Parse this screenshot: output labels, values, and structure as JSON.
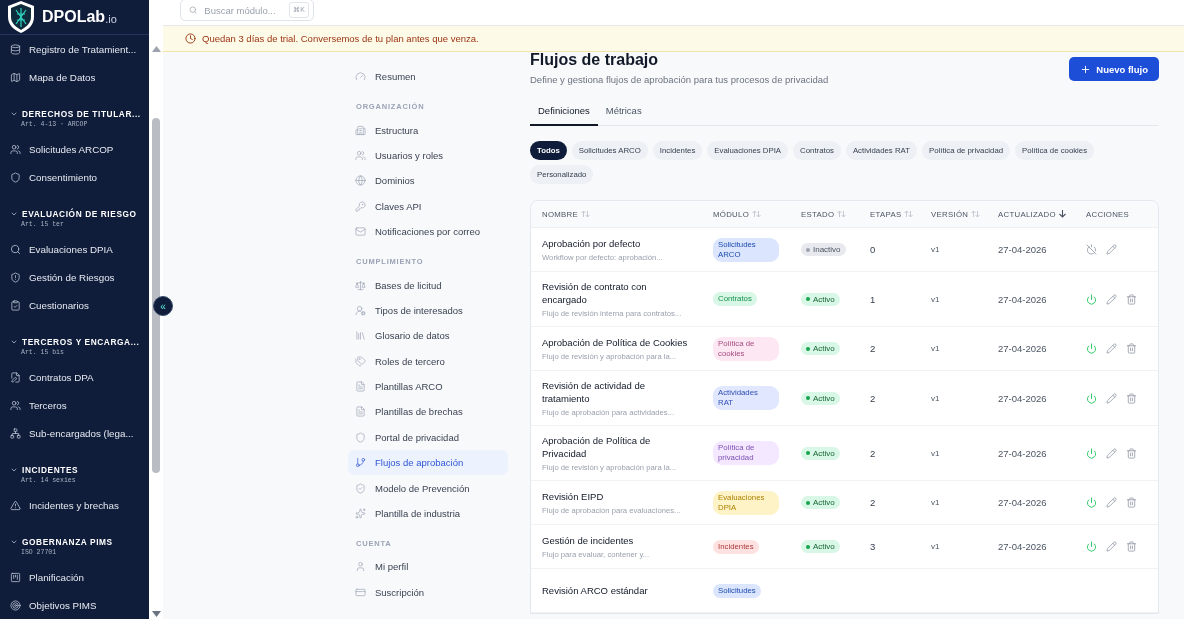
{
  "sidebar": {
    "logo": {
      "name": "DPOLab",
      "suffix": ".io"
    },
    "top_items": [
      {
        "label": "Registro de Tratamient..."
      },
      {
        "label": "Mapa de Datos"
      }
    ],
    "groups": [
      {
        "title": "DERECHOS DE TITULAR...",
        "subtitle": "Art. 4-13 · ARCOP",
        "expanded": true,
        "items": [
          {
            "label": "Solicitudes ARCOP"
          },
          {
            "label": "Consentimiento"
          }
        ]
      },
      {
        "title": "EVALUACIÓN DE RIESGO",
        "subtitle": "Art. 15 ter",
        "expanded": true,
        "items": [
          {
            "label": "Evaluaciones DPIA"
          },
          {
            "label": "Gestión de Riesgos"
          },
          {
            "label": "Cuestionarios"
          }
        ]
      },
      {
        "title": "TERCEROS Y ENCARGA...",
        "subtitle": "Art. 15 bis",
        "expanded": true,
        "items": [
          {
            "label": "Contratos DPA"
          },
          {
            "label": "Terceros"
          },
          {
            "label": "Sub-encargados (lega..."
          }
        ]
      },
      {
        "title": "INCIDENTES",
        "subtitle": "Art. 14 sexies",
        "expanded": true,
        "items": [
          {
            "label": "Incidentes y brechas"
          }
        ]
      },
      {
        "title": "GOBERNANZA PIMS",
        "subtitle": "ISO 27701",
        "expanded": true,
        "items": [
          {
            "label": "Planificación"
          },
          {
            "label": "Objetivos PIMS"
          }
        ]
      }
    ],
    "collapse_button": "«"
  },
  "search": {
    "placeholder": "Buscar módulo...",
    "shortcut": "⌘K"
  },
  "trial_banner": "Quedan 3 días de trial. Conversemos de tu plan antes que venza.",
  "settings_nav": {
    "top": [
      {
        "label": "Resumen",
        "selected": false
      }
    ],
    "sections": [
      {
        "title": "ORGANIZACIÓN",
        "items": [
          {
            "label": "Estructura",
            "selected": false
          },
          {
            "label": "Usuarios y roles",
            "selected": false
          },
          {
            "label": "Dominios",
            "selected": false
          },
          {
            "label": "Claves API",
            "selected": false
          },
          {
            "label": "Notificaciones por correo",
            "selected": false
          }
        ]
      },
      {
        "title": "CUMPLIMIENTO",
        "items": [
          {
            "label": "Bases de licitud",
            "selected": false
          },
          {
            "label": "Tipos de interesados",
            "selected": false
          },
          {
            "label": "Glosario de datos",
            "selected": false
          },
          {
            "label": "Roles de tercero",
            "selected": false
          },
          {
            "label": "Plantillas ARCO",
            "selected": false
          },
          {
            "label": "Plantillas de brechas",
            "selected": false
          },
          {
            "label": "Portal de privacidad",
            "selected": false
          },
          {
            "label": "Flujos de aprobación",
            "selected": true
          },
          {
            "label": "Modelo de Prevención",
            "selected": false
          },
          {
            "label": "Plantilla de industria",
            "selected": false
          }
        ]
      },
      {
        "title": "CUENTA",
        "items": [
          {
            "label": "Mi perfil",
            "selected": false
          },
          {
            "label": "Suscripción",
            "selected": false
          }
        ]
      }
    ]
  },
  "page": {
    "title": "Flujos de trabajo",
    "subtitle": "Define y gestiona flujos de aprobación para tus procesos de privacidad",
    "new_button": "Nuevo flujo"
  },
  "tabs": [
    {
      "label": "Definiciones",
      "selected": true
    },
    {
      "label": "Métricas",
      "selected": false
    }
  ],
  "filters": [
    {
      "label": "Todos",
      "selected": true
    },
    {
      "label": "Solicitudes ARCO",
      "selected": false
    },
    {
      "label": "Incidentes",
      "selected": false
    },
    {
      "label": "Evaluaciones DPIA",
      "selected": false
    },
    {
      "label": "Contratos",
      "selected": false
    },
    {
      "label": "Actividades RAT",
      "selected": false
    },
    {
      "label": "Política de privacidad",
      "selected": false
    },
    {
      "label": "Política de cookies",
      "selected": false
    },
    {
      "label": "Personalizado",
      "selected": false
    }
  ],
  "table": {
    "columns": [
      {
        "label": "NOMBRE",
        "sorted": false
      },
      {
        "label": "MÓDULO",
        "sorted": false
      },
      {
        "label": "ESTADO",
        "sorted": false
      },
      {
        "label": "ETAPAS",
        "sorted": false
      },
      {
        "label": "VERSIÓN",
        "sorted": false
      },
      {
        "label": "ACTUALIZADO",
        "sorted": true
      },
      {
        "label": "ACCIONES"
      }
    ],
    "rows": [
      {
        "name": "Aprobación por defecto",
        "description": "Workflow por defecto: aprobación...",
        "module": "Solicitudes ARCO",
        "color": "#dbe6fe",
        "status": "Inactivo",
        "active": false,
        "stages": "0",
        "version": "v1",
        "updated": "27-04-2026"
      },
      {
        "name": "Revisión de contrato con encargado",
        "description": "Flujo de revisión interna para contratos...",
        "module": "Contratos",
        "color": "#d9f7e6",
        "status": "Activo",
        "active": true,
        "stages": "1",
        "version": "v1",
        "updated": "27-04-2026"
      },
      {
        "name": "Aprobación de Política de Cookies",
        "description": "Flujo de revisión y aprobación para la...",
        "module": "Política de cookies",
        "color": "#fce7f3",
        "status": "Activo",
        "active": true,
        "stages": "2",
        "version": "v1",
        "updated": "27-04-2026"
      },
      {
        "name": "Revisión de actividad de tratamiento",
        "description": "Flujo de aprobación para actividades...",
        "module": "Actividades RAT",
        "color": "#e0e7ff",
        "status": "Activo",
        "active": true,
        "stages": "2",
        "version": "v1",
        "updated": "27-04-2026"
      },
      {
        "name": "Aprobación de Política de Privacidad",
        "description": "Flujo de revisión y aprobación para la...",
        "module": "Política de privacidad",
        "color": "#f3e8ff",
        "status": "Activo",
        "active": true,
        "stages": "2",
        "version": "v1",
        "updated": "27-04-2026"
      },
      {
        "name": "Revisión EIPD",
        "description": "Flujo de aprobación para evaluaciones...",
        "module": "Evaluaciones DPIA",
        "color": "#fef3c7",
        "status": "Activo",
        "active": true,
        "stages": "2",
        "version": "v1",
        "updated": "27-04-2026"
      },
      {
        "name": "Gestión de incidentes",
        "description": "Flujo para evaluar, contener y...",
        "module": "Incidentes",
        "color": "#fee2e2",
        "status": "Activo",
        "active": true,
        "stages": "3",
        "version": "v1",
        "updated": "27-04-2026"
      },
      {
        "name": "Revisión ARCO estándar",
        "module": "Solicitudes",
        "color": "#dbe6fe"
      }
    ]
  }
}
